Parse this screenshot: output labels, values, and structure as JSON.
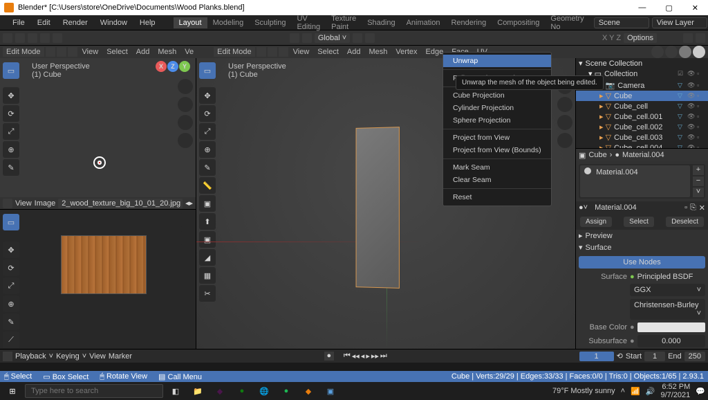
{
  "title": "Blender* [C:\\Users\\store\\OneDrive\\Documents\\Wood Planks.blend]",
  "topmenu": {
    "file": "File",
    "edit": "Edit",
    "render": "Render",
    "window": "Window",
    "help": "Help"
  },
  "workspaces": [
    "Layout",
    "Modeling",
    "Sculpting",
    "UV Editing",
    "Texture Paint",
    "Shading",
    "Animation",
    "Rendering",
    "Compositing",
    "Geometry No"
  ],
  "active_workspace": "Layout",
  "scene_field": "Scene",
  "viewlayer_field": "View Layer",
  "editor_mode": "Edit Mode",
  "vpmenu": [
    "View",
    "Select",
    "Add",
    "Mesh",
    "Vertex",
    "Edge",
    "Face",
    "UV"
  ],
  "header_global": "Global",
  "header_options": "Options",
  "persp_label_1": "User Perspective",
  "persp_label_2": "(1) Cube",
  "img_header": {
    "view": "View",
    "image": "Image",
    "filename": "2_wood_texture_big_10_01_20.jpg"
  },
  "outliner_title": "Scene Collection",
  "outliner_collection": "Collection",
  "outliner_items": [
    {
      "name": "Camera",
      "icon": "camera"
    },
    {
      "name": "Cube",
      "icon": "mesh",
      "sel": true
    },
    {
      "name": "Cube_cell",
      "icon": "mesh"
    },
    {
      "name": "Cube_cell.001",
      "icon": "mesh"
    },
    {
      "name": "Cube_cell.002",
      "icon": "mesh"
    },
    {
      "name": "Cube_cell.003",
      "icon": "mesh"
    },
    {
      "name": "Cube_cell.004",
      "icon": "mesh"
    }
  ],
  "props_object": "Cube",
  "props_material": "Material.004",
  "matlist_item": "Material.004",
  "mat_field": "Material.004",
  "assign_btn": "Assign",
  "select_btn": "Select",
  "deselect_btn": "Deselect",
  "preview_label": "Preview",
  "surface_label": "Surface",
  "usenodes_btn": "Use Nodes",
  "surface_row_lbl": "Surface",
  "surface_row_val": "Principled BSDF",
  "ggx_val": "GGX",
  "burley_val": "Christensen-Burley",
  "basecolor_lbl": "Base Color",
  "subsurf_lbl": "Subsurface",
  "subsurf_val": "0.000",
  "timeline": {
    "playback": "Playback",
    "keying": "Keying",
    "view": "View",
    "marker": "Marker",
    "frame": "1",
    "start_lbl": "Start",
    "start": "1",
    "end_lbl": "End",
    "end": "250"
  },
  "uv_menu": {
    "unwrap": "Unwrap",
    "tooltip": "Unwrap the mesh of the object being edited.",
    "follow": "Follow Active Quads",
    "cube": "Cube Projection",
    "cyl": "Cylinder Projection",
    "sphere": "Sphere Projection",
    "view": "Project from View",
    "bounds": "Project from View (Bounds)",
    "mark": "Mark Seam",
    "clear": "Clear Seam",
    "reset": "Reset"
  },
  "footer": {
    "select": "Select",
    "box": "Box Select",
    "rotate": "Rotate View",
    "callmenu": "Call Menu",
    "stats": "Cube | Verts:29/29 | Edges:33/33 | Faces:0/0 | Tris:0 | Objects:1/65 | 2.93.1"
  },
  "taskbar": {
    "search_ph": "Type here to search",
    "weather": "79°F  Mostly sunny",
    "time": "6:52 PM",
    "date": "9/7/2021"
  }
}
